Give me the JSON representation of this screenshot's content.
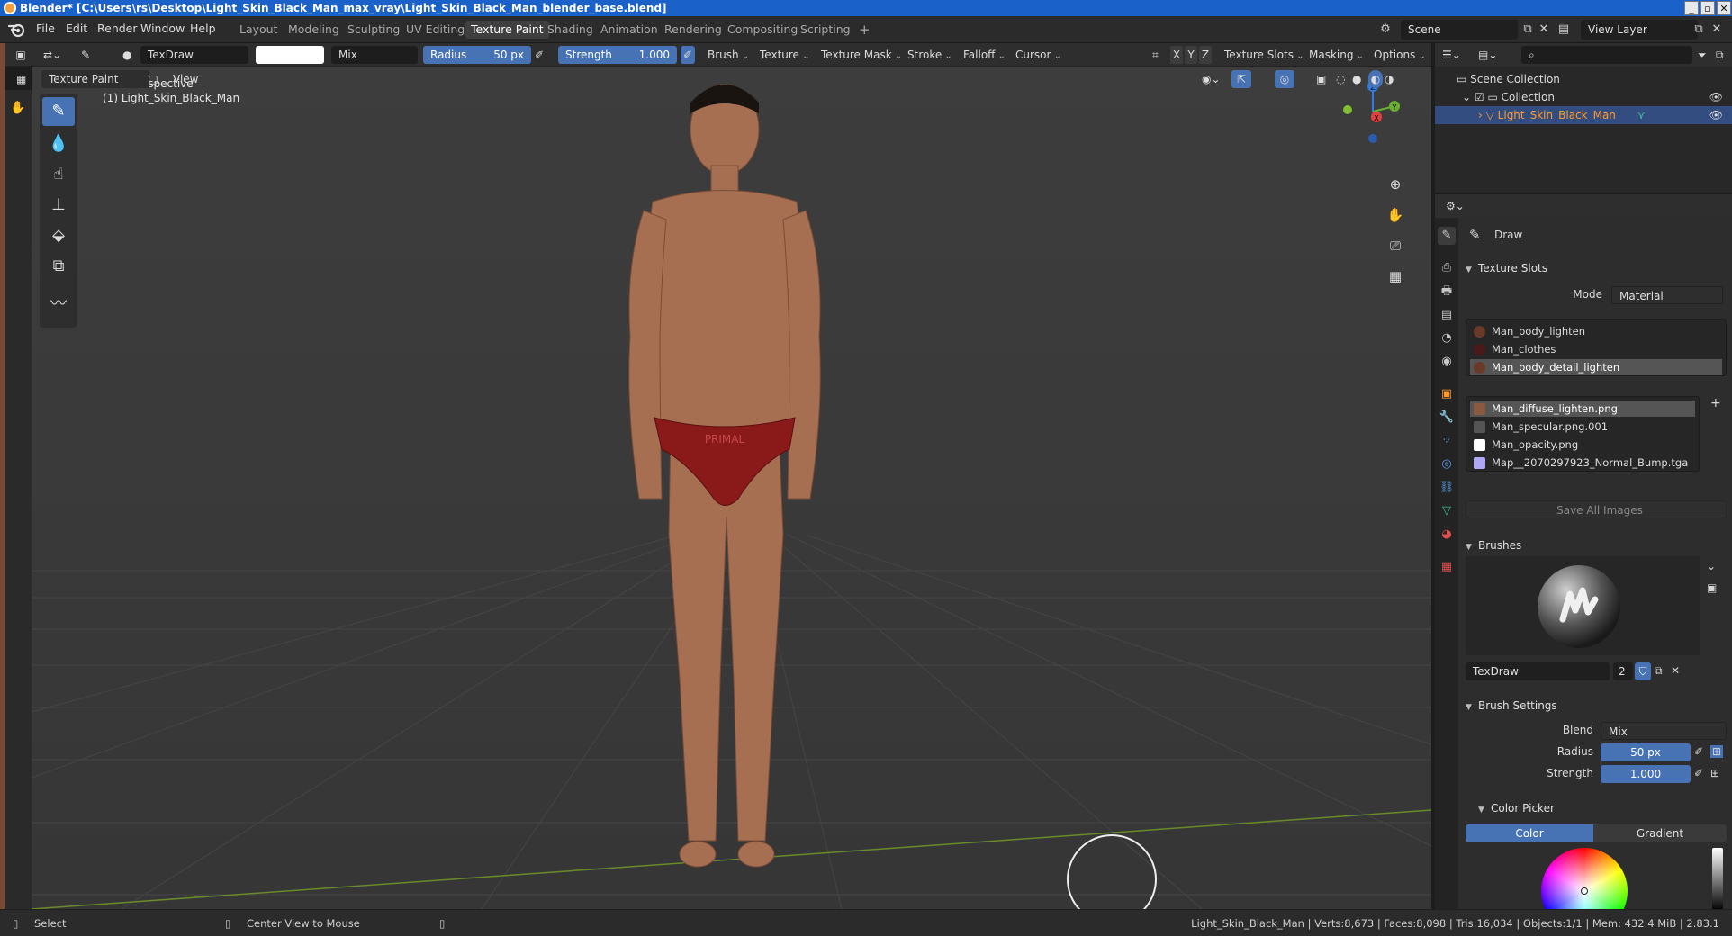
{
  "window": {
    "title": "Blender* [C:\\Users\\rs\\Desktop\\Light_Skin_Black_Man_max_vray\\Light_Skin_Black_Man_blender_base.blend]",
    "controls": [
      "_",
      "▫",
      "✕"
    ]
  },
  "menu": {
    "items": [
      "File",
      "Edit",
      "Render",
      "Window",
      "Help"
    ]
  },
  "workspaces": {
    "tabs": [
      "Layout",
      "Modeling",
      "Sculpting",
      "UV Editing",
      "Texture Paint",
      "Shading",
      "Animation",
      "Rendering",
      "Compositing",
      "Scripting"
    ],
    "active": "Texture Paint",
    "add": "+"
  },
  "scene": {
    "name": "Scene",
    "view_layer": "View Layer"
  },
  "tool_header": {
    "brush_name": "TexDraw",
    "blend": "Mix",
    "radius_label": "Radius",
    "radius_value": "50 px",
    "strength_label": "Strength",
    "strength_value": "1.000",
    "menus": [
      "Brush",
      "Texture",
      "Texture Mask",
      "Stroke",
      "Falloff",
      "Cursor"
    ],
    "axes": [
      "X",
      "Y",
      "Z"
    ],
    "right_menus": [
      "Texture Slots",
      "Masking",
      "Options"
    ],
    "mode": "Texture Paint",
    "view": "View"
  },
  "viewport": {
    "perspective": "User Perspective",
    "object_label": "(1) Light_Skin_Black_Man",
    "gizmo_axes": [
      "Z",
      "X",
      "Y"
    ],
    "underwear_print": "PRIMAL"
  },
  "outliner": {
    "rows": [
      "Scene Collection",
      "Collection",
      "Light_Skin_Black_Man"
    ]
  },
  "properties": {
    "tool_name": "Draw",
    "texture_slots": {
      "title": "Texture Slots",
      "mode_label": "Mode",
      "mode_value": "Material",
      "materials": [
        "Man_body_lighten",
        "Man_clothes",
        "Man_body_detail_lighten"
      ],
      "images": [
        "Man_diffuse_lighten.png",
        "Man_specular.png.001",
        "Man_opacity.png",
        "Map__2070297923_Normal_Bump.tga"
      ],
      "save_all": "Save All Images"
    },
    "brushes": {
      "title": "Brushes",
      "brush_name": "TexDraw",
      "users": "2"
    },
    "brush_settings": {
      "title": "Brush Settings",
      "blend_label": "Blend",
      "blend_value": "Mix",
      "radius_label": "Radius",
      "radius_value": "50 px",
      "strength_label": "Strength",
      "strength_value": "1.000"
    },
    "color_picker": {
      "title": "Color Picker",
      "tabs": [
        "Color",
        "Gradient"
      ]
    }
  },
  "status": {
    "select": "Select",
    "center": "Center View to Mouse",
    "stats": "Light_Skin_Black_Man | Verts:8,673 | Faces:8,098 | Tris:16,034 | Objects:1/1 | Mem: 432.4 MiB | 2.83.1"
  },
  "colors": {
    "accent": "#4772b3",
    "title_bar": "#1a61c9",
    "selection": "#334d80",
    "object_orange": "#ff9a30"
  }
}
